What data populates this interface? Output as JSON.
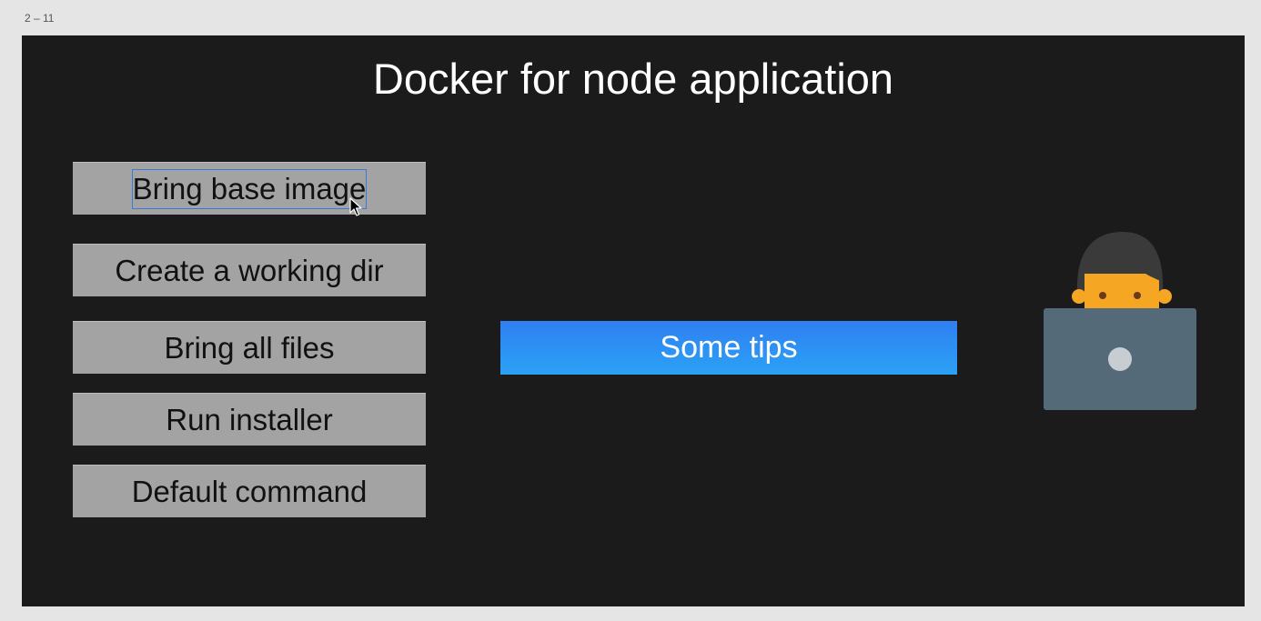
{
  "frame": {
    "label": "2 – 11"
  },
  "slide": {
    "title": "Docker for node application",
    "steps": [
      {
        "label": "Bring base image",
        "selected": true
      },
      {
        "label": "Create a working dir",
        "selected": false
      },
      {
        "label": "Bring all files",
        "selected": false
      },
      {
        "label": "Run installer",
        "selected": false
      },
      {
        "label": "Default command",
        "selected": false
      }
    ],
    "tips_button": {
      "label": "Some tips"
    },
    "illustration": {
      "icon": "developer-at-laptop-icon"
    }
  },
  "colors": {
    "slide_background": "#1b1b1b",
    "step_background": "#a3a3a3",
    "tips_gradient_top": "#2f7ff2",
    "tips_gradient_bottom": "#2ba2f5",
    "selection_outline": "#3a7bd5"
  }
}
